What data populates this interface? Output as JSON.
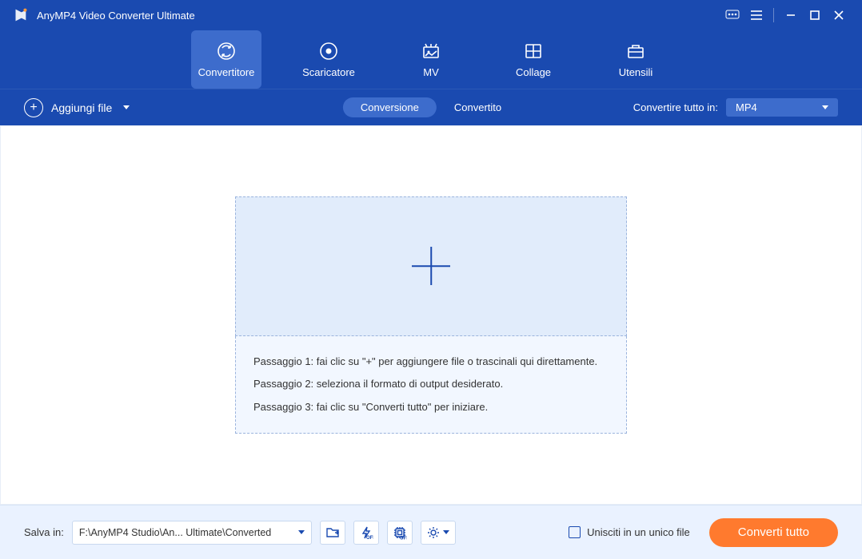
{
  "titlebar": {
    "app_name": "AnyMP4 Video Converter Ultimate"
  },
  "nav": {
    "items": [
      {
        "label": "Convertitore"
      },
      {
        "label": "Scaricatore"
      },
      {
        "label": "MV"
      },
      {
        "label": "Collage"
      },
      {
        "label": "Utensili"
      }
    ]
  },
  "subbar": {
    "add_file": "Aggiungi file",
    "seg_convert": "Conversione",
    "seg_converted": "Convertito",
    "convert_all_label": "Convertire tutto in:",
    "format": "MP4"
  },
  "drop": {
    "step1": "Passaggio 1: fai clic su \"+\" per aggiungere file o trascinali qui direttamente.",
    "step2": "Passaggio 2: seleziona il formato di output desiderato.",
    "step3": "Passaggio 3: fai clic su \"Converti tutto\" per iniziare."
  },
  "footer": {
    "save_label": "Salva in:",
    "path": "F:\\AnyMP4 Studio\\An... Ultimate\\Converted",
    "merge_label": "Unisciti in un unico file",
    "convert_button": "Converti tutto"
  }
}
